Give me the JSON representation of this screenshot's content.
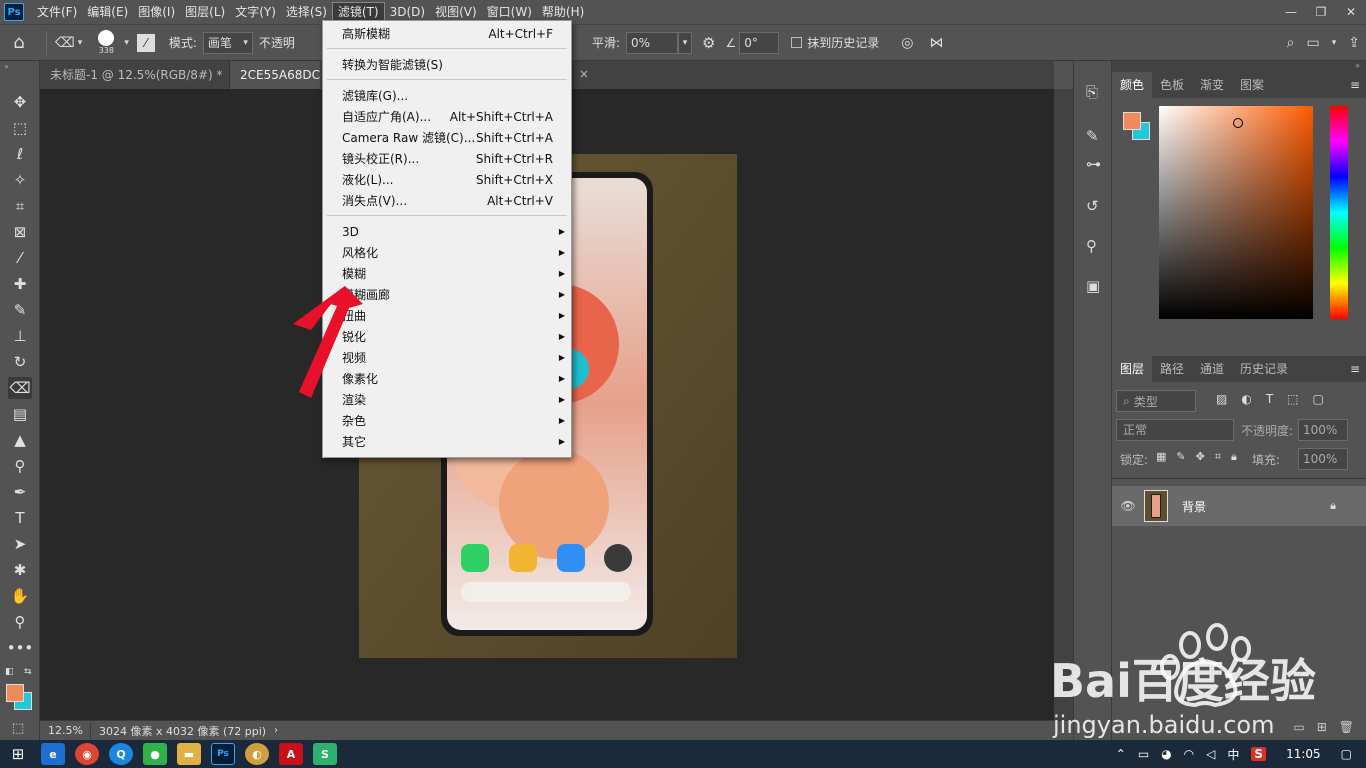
{
  "app": {
    "logo": "Ps",
    "menus": [
      "文件(F)",
      "编辑(E)",
      "图像(I)",
      "图层(L)",
      "文字(Y)",
      "选择(S)",
      "滤镜(T)",
      "3D(D)",
      "视图(V)",
      "窗口(W)",
      "帮助(H)"
    ],
    "active_menu_index": 6
  },
  "options_bar": {
    "brush_size": "338",
    "mode_label": "模式:",
    "mode_value": "画笔",
    "opacity_label": "不透明",
    "smooth_label": "平滑:",
    "smooth_value": "0%",
    "angle_value": "0°",
    "erase_history_label": "抹到历史记录"
  },
  "tabs": [
    {
      "label": "未标题-1 @ 12.5%(RGB/8#) *",
      "active": false
    },
    {
      "label": "2CE55A68DCAE",
      "active": true
    }
  ],
  "filter_menu": {
    "items": [
      {
        "label": "高斯模糊",
        "shortcut": "Alt+Ctrl+F",
        "submenu": false
      },
      {
        "sep": true
      },
      {
        "label": "转换为智能滤镜(S)",
        "shortcut": "",
        "submenu": false
      },
      {
        "sep": true
      },
      {
        "label": "滤镜库(G)...",
        "shortcut": "",
        "submenu": false
      },
      {
        "label": "自适应广角(A)...",
        "shortcut": "Alt+Shift+Ctrl+A",
        "submenu": false
      },
      {
        "label": "Camera Raw 滤镜(C)...",
        "shortcut": "Shift+Ctrl+A",
        "submenu": false
      },
      {
        "label": "镜头校正(R)...",
        "shortcut": "Shift+Ctrl+R",
        "submenu": false
      },
      {
        "label": "液化(L)...",
        "shortcut": "Shift+Ctrl+X",
        "submenu": false
      },
      {
        "label": "消失点(V)...",
        "shortcut": "Alt+Ctrl+V",
        "submenu": false
      },
      {
        "sep": true
      },
      {
        "label": "3D",
        "shortcut": "",
        "submenu": true
      },
      {
        "label": "风格化",
        "shortcut": "",
        "submenu": true
      },
      {
        "label": "模糊",
        "shortcut": "",
        "submenu": true
      },
      {
        "label": "模糊画廊",
        "shortcut": "",
        "submenu": true
      },
      {
        "label": "扭曲",
        "shortcut": "",
        "submenu": true
      },
      {
        "label": "锐化",
        "shortcut": "",
        "submenu": true
      },
      {
        "label": "视频",
        "shortcut": "",
        "submenu": true
      },
      {
        "label": "像素化",
        "shortcut": "",
        "submenu": true
      },
      {
        "label": "渲染",
        "shortcut": "",
        "submenu": true
      },
      {
        "label": "杂色",
        "shortcut": "",
        "submenu": true
      },
      {
        "label": "其它",
        "shortcut": "",
        "submenu": true
      }
    ]
  },
  "color_panel": {
    "tabs": [
      "颜色",
      "色板",
      "渐变",
      "图案"
    ],
    "foreground": "#f08a5d",
    "background": "#22c8d8"
  },
  "layers_panel": {
    "tabs": [
      "图层",
      "路径",
      "通道",
      "历史记录"
    ],
    "filter_placeholder": "类型",
    "blend_mode": "正常",
    "opacity_label": "不透明度:",
    "opacity_value": "100%",
    "lock_label": "锁定:",
    "fill_label": "填充:",
    "fill_value": "100%",
    "layers": [
      {
        "name": "背景",
        "locked": true,
        "visible": true
      }
    ]
  },
  "status": {
    "zoom": "12.5%",
    "doc_info": "3024 像素 x 4032 像素 (72 ppi)"
  },
  "watermark": {
    "brand": "Bai百度经验",
    "url": "jingyan.baidu.com"
  },
  "taskbar": {
    "time": "11:05",
    "ime": "中"
  }
}
